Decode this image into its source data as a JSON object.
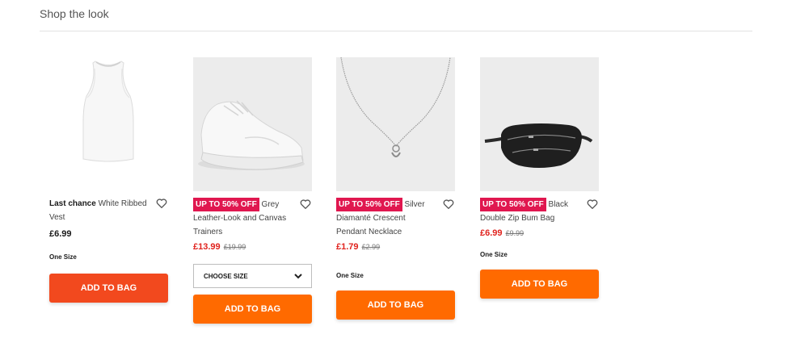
{
  "section_title": "Shop the look",
  "colors": {
    "badge": "#e0174f",
    "sale_price": "#e0231e",
    "add_button": "#ff6a00",
    "add_button_first": "#f2491e"
  },
  "products": [
    {
      "badge": "",
      "highlight": "Last chance",
      "name_line1": " White Ribbed",
      "name_rest": "Vest",
      "price": "£6.99",
      "old_price": "",
      "size_label": "One Size",
      "size_select": "",
      "button": "ADD TO BAG",
      "image_icon": "white-vest-image"
    },
    {
      "badge": "UP TO 50% OFF",
      "highlight": "",
      "name_line1": " Grey",
      "name_rest": "Leather-Look and Canvas Trainers",
      "price": "£13.99",
      "old_price": "£19.99",
      "size_label": "",
      "size_select": "CHOOSE SIZE",
      "button": "ADD TO BAG",
      "image_icon": "white-trainer-image"
    },
    {
      "badge": "UP TO 50% OFF",
      "highlight": "",
      "name_line1": " Silver",
      "name_rest": "Diamanté Crescent Pendant Necklace",
      "price": "£1.79",
      "old_price": "£2.99",
      "size_label": "One Size",
      "size_select": "",
      "button": "ADD TO BAG",
      "image_icon": "necklace-image"
    },
    {
      "badge": "UP TO 50% OFF",
      "highlight": "",
      "name_line1": " Black",
      "name_rest": "Double Zip Bum Bag",
      "price": "£6.99",
      "old_price": "£9.99",
      "size_label": "One Size",
      "size_select": "",
      "button": "ADD TO BAG",
      "image_icon": "bum-bag-image"
    }
  ]
}
